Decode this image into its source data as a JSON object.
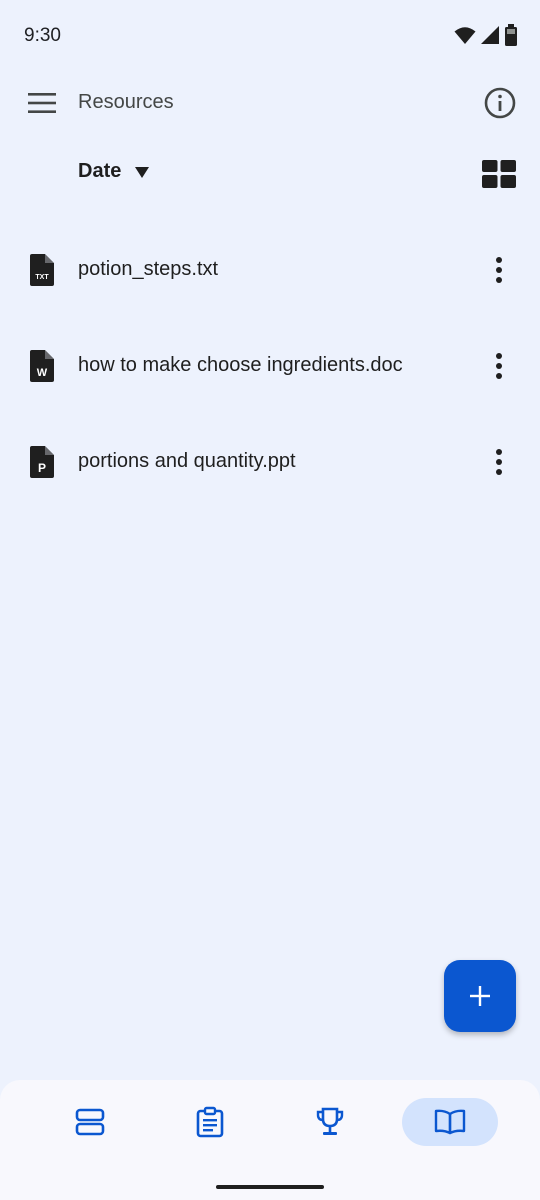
{
  "status": {
    "time": "9:30"
  },
  "header": {
    "title": "Resources",
    "menu_icon": "menu-icon",
    "info_icon": "info-icon"
  },
  "sort": {
    "label": "Date",
    "arrow_icon": "dropdown-arrow-icon",
    "view_icon": "grid-view-icon"
  },
  "files": [
    {
      "name": "potion_steps.txt",
      "icon": "txt-file-icon",
      "badge": "TXT"
    },
    {
      "name": "how to make choose ingredients.doc",
      "icon": "doc-file-icon",
      "badge": "W"
    },
    {
      "name": "portions and quantity.ppt",
      "icon": "ppt-file-icon",
      "badge": "P"
    }
  ],
  "fab": {
    "icon": "add-icon"
  },
  "bottom_nav": [
    {
      "icon": "stream-icon",
      "active": false
    },
    {
      "icon": "assignment-icon",
      "active": false
    },
    {
      "icon": "trophy-icon",
      "active": false
    },
    {
      "icon": "book-icon",
      "active": true
    }
  ],
  "colors": {
    "background": "#edf2fd",
    "accent": "#0b57d0",
    "nav_active": "#d3e3fd",
    "text": "#1f1f1f"
  }
}
